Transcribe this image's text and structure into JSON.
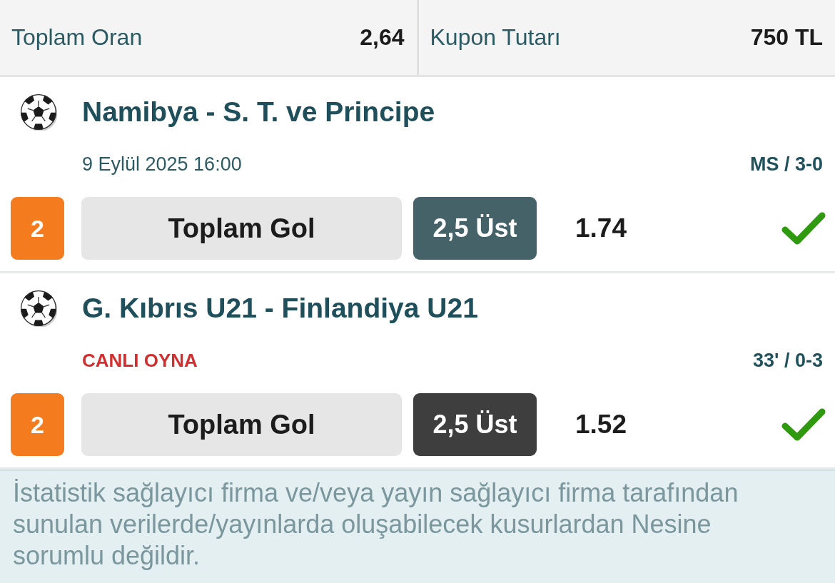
{
  "summary": [
    {
      "label": "Toplam Oran",
      "value": "2,64"
    },
    {
      "label": "Kupon Tutarı",
      "value": "750 TL"
    }
  ],
  "matches": [
    {
      "title": "Namibya - S. T. ve Principe",
      "live": false,
      "info": "9 Eylül 2025 16:00",
      "result": "MS / 3-0",
      "badge": "2",
      "market": "Toplam Gol",
      "pick": "2,5 Üst",
      "odds": "1.74",
      "won": true
    },
    {
      "title": "G. Kıbrıs U21 - Finlandiya U21",
      "live": true,
      "info": "CANLI OYNA",
      "result": "33' / 0-3",
      "badge": "2",
      "market": "Toplam Gol",
      "pick": "2,5 Üst",
      "odds": "1.52",
      "won": true
    }
  ],
  "disclaimer": "İstatistik sağlayıcı firma ve/veya yayın sağlayıcı firma tarafından sunulan verilerde/yayınlarda oluşabilecek kusurlardan Nesine sorumlu değildir."
}
